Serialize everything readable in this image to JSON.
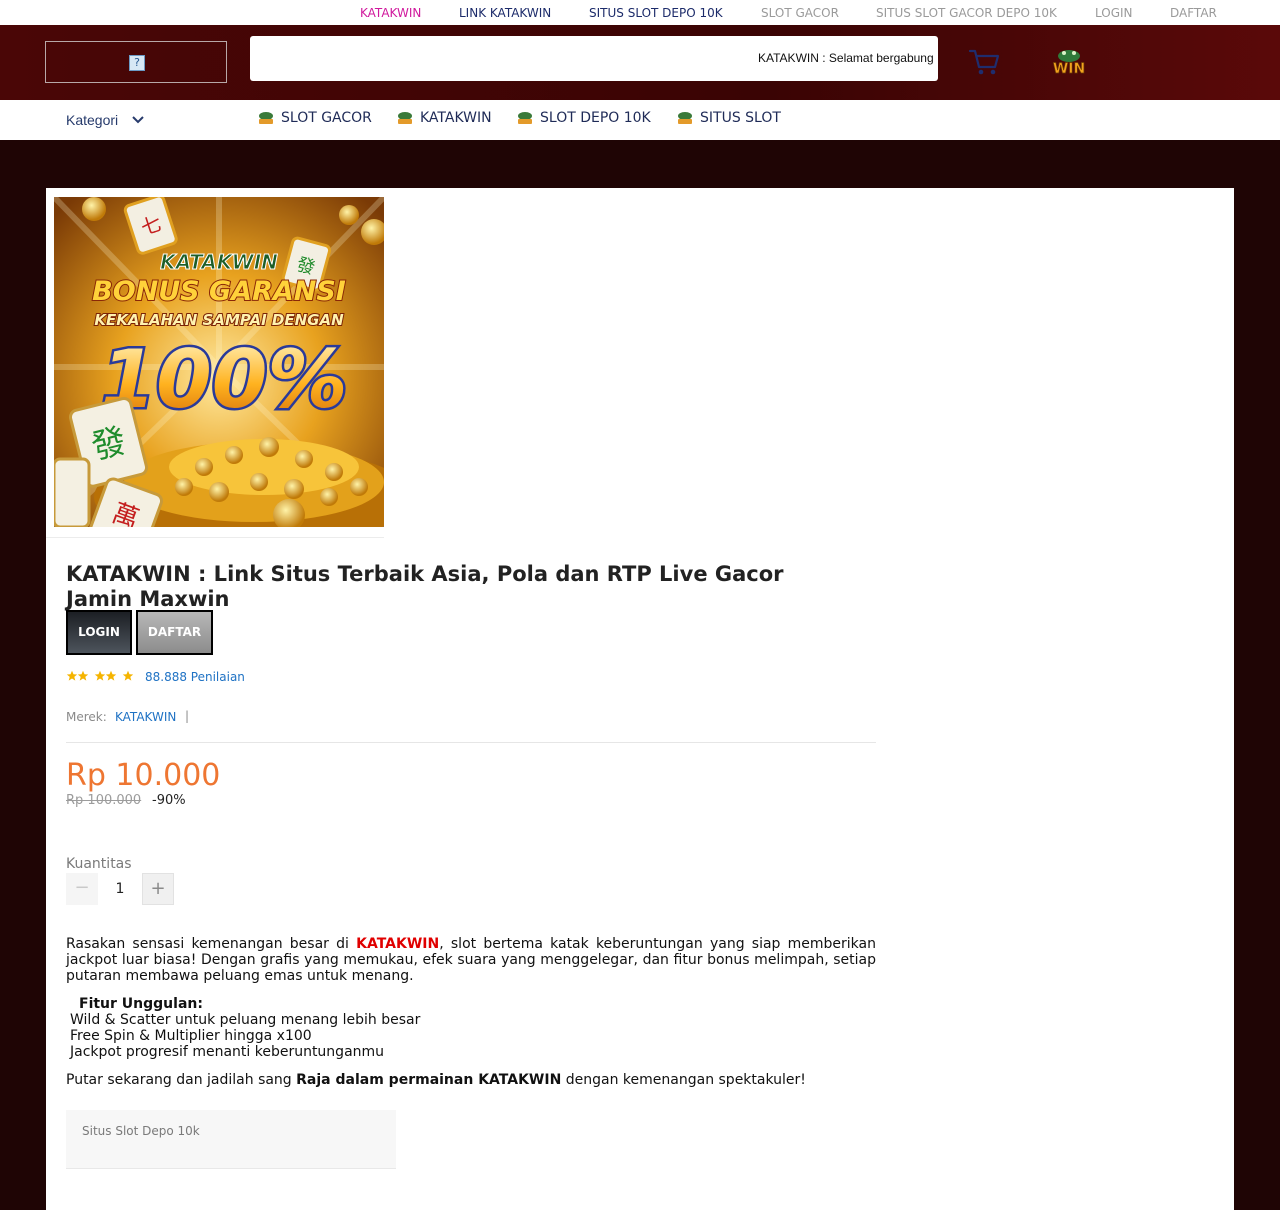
{
  "top_links": [
    {
      "label": "KATAKWIN",
      "color": "#d0199d"
    },
    {
      "label": "LINK KATAKWIN",
      "color": "#1c2b6a"
    },
    {
      "label": "SITUS SLOT DEPO 10K",
      "color": "#1c2b6a"
    },
    {
      "label": "SLOT GACOR",
      "color": "#9a9a9a"
    },
    {
      "label": "SITUS SLOT GACOR DEPO 10K",
      "color": "#9a9a9a"
    },
    {
      "label": "LOGIN",
      "color": "#9a9a9a"
    },
    {
      "label": "DAFTAR",
      "color": "#9a9a9a"
    }
  ],
  "header": {
    "marquee": "KATAKWIN : Selamat bergabung",
    "cart_icon": "cart-icon",
    "logo_text": "WIN"
  },
  "nav": {
    "kategori": "Kategori",
    "items": [
      "SLOT GACOR",
      "KATAKWIN",
      "SLOT DEPO 10K",
      "SITUS SLOT"
    ]
  },
  "banner": {
    "brand": "KATAKWIN",
    "headline": "BONUS GARANSI",
    "subline": "KEKALAHAN SAMPAI DENGAN",
    "percent": "100%"
  },
  "product": {
    "title": "KATAKWIN : Link Situs Terbaik Asia, Pola dan RTP Live Gacor Jamin Maxwin",
    "login_label": "LOGIN",
    "daftar_label": "DAFTAR",
    "rating_stars": 5,
    "reviews": "88.888 Penilaian",
    "merek_label": "Merek:",
    "merek_value": "KATAKWIN",
    "merek_sep": "|",
    "price": "Rp 10.000",
    "old_price": "Rp 100.000",
    "discount": "-90%",
    "qty_label": "Kuantitas",
    "qty_value": "1"
  },
  "description": {
    "intro_before": "Rasakan sensasi kemenangan besar di ",
    "intro_brand": "KATAKWIN",
    "intro_after": ", slot bertema katak keberuntungan yang siap memberikan jackpot luar biasa! Dengan grafis yang memukau, efek suara yang menggelegar, dan fitur bonus melimpah, setiap putaran membawa peluang emas untuk menang.",
    "features_title": "Fitur Unggulan:",
    "features": [
      "Wild & Scatter untuk peluang menang lebih besar",
      "Free Spin & Multiplier hingga x100",
      "Jackpot progresif menanti keberuntunganmu"
    ],
    "closing_before": "Putar sekarang dan jadilah sang ",
    "closing_bold": "Raja dalam permainan KATAKWIN",
    "closing_after": " dengan kemenangan spektakuler!"
  },
  "tag": "Situs Slot Depo 10k",
  "colors": {
    "header_bg": "#4a0606",
    "page_bg": "#1f0505",
    "price": "#ee7632",
    "link": "#1f72c4",
    "star": "#f5b400"
  }
}
